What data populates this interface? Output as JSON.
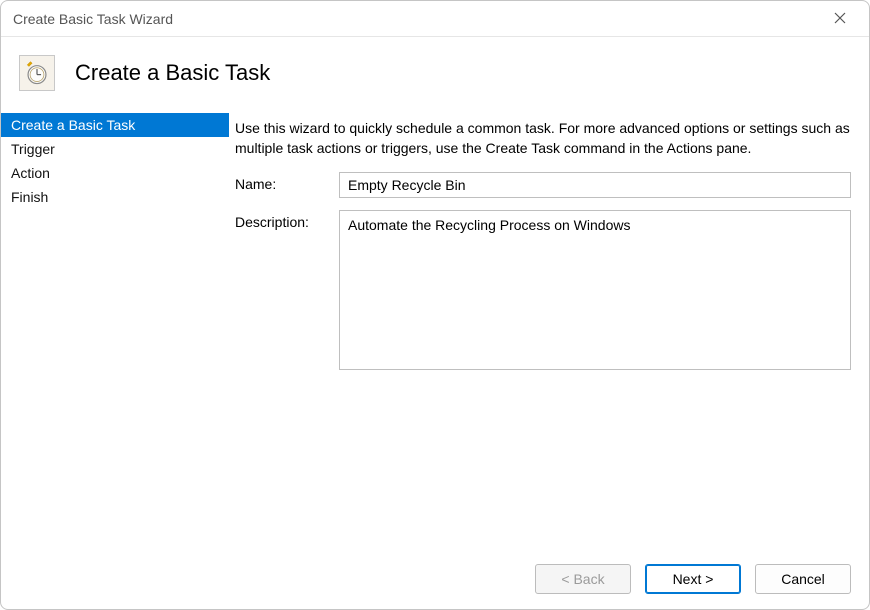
{
  "window": {
    "title": "Create Basic Task Wizard"
  },
  "header": {
    "title": "Create a Basic Task"
  },
  "sidebar": {
    "items": [
      {
        "label": "Create a Basic Task",
        "active": true
      },
      {
        "label": "Trigger",
        "active": false
      },
      {
        "label": "Action",
        "active": false
      },
      {
        "label": "Finish",
        "active": false
      }
    ]
  },
  "main": {
    "intro": "Use this wizard to quickly schedule a common task.  For more advanced options or settings such as multiple task actions or triggers, use the Create Task command in the Actions pane.",
    "name_label": "Name:",
    "name_value": "Empty Recycle Bin",
    "description_label": "Description:",
    "description_value": "Automate the Recycling Process on Windows"
  },
  "footer": {
    "back_label": "< Back",
    "next_label": "Next >",
    "cancel_label": "Cancel"
  }
}
